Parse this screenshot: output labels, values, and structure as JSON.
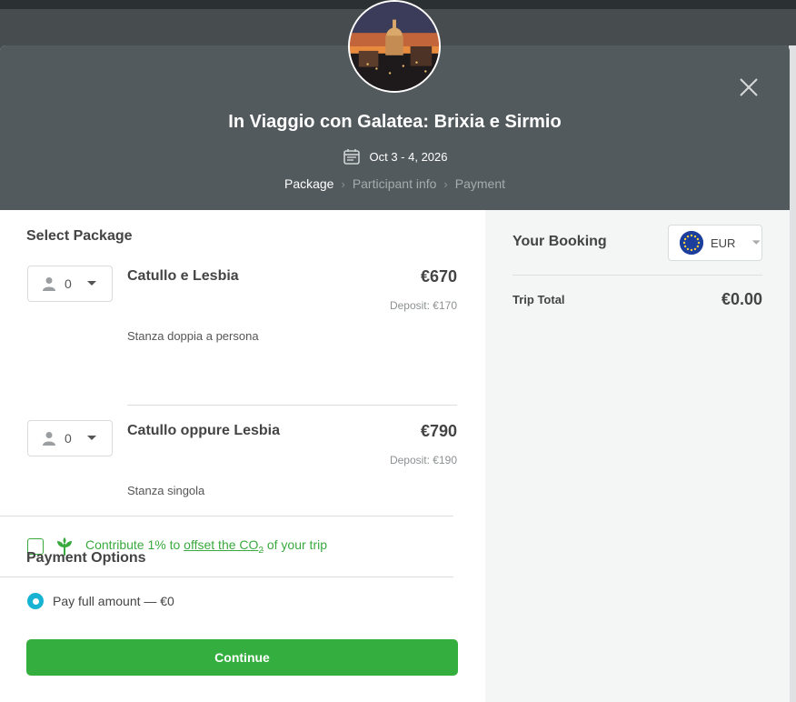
{
  "header": {
    "title": "In Viaggio con Galatea: Brixia e Sirmio",
    "dates": "Oct 3 - 4, 2026",
    "steps": [
      "Package",
      "Participant info",
      "Payment"
    ],
    "active_step": "Package"
  },
  "packages_section": {
    "title": "Select Package",
    "items": [
      {
        "qty": "0",
        "name": "Catullo e Lesbia",
        "price": "€670",
        "deposit": "Deposit: €170",
        "description": "Stanza doppia a persona"
      },
      {
        "qty": "0",
        "name": "Catullo oppure Lesbia",
        "price": "€790",
        "deposit": "Deposit: €190",
        "description": "Stanza singola"
      }
    ]
  },
  "co2": {
    "prefix": "Contribute 1% to ",
    "link": "offset the CO",
    "sub": "2",
    "suffix": " of your trip",
    "checked": false
  },
  "payment": {
    "title": "Payment Options",
    "option_label": "Pay full amount — €0",
    "continue_label": "Continue"
  },
  "booking": {
    "title": "Your Booking",
    "currency": "EUR",
    "trip_total_label": "Trip Total",
    "trip_total_value": "€0.00"
  },
  "colors": {
    "accent_green": "#34ae3e",
    "radio_blue": "#18b3d3",
    "header_bg": "#535a5d"
  }
}
